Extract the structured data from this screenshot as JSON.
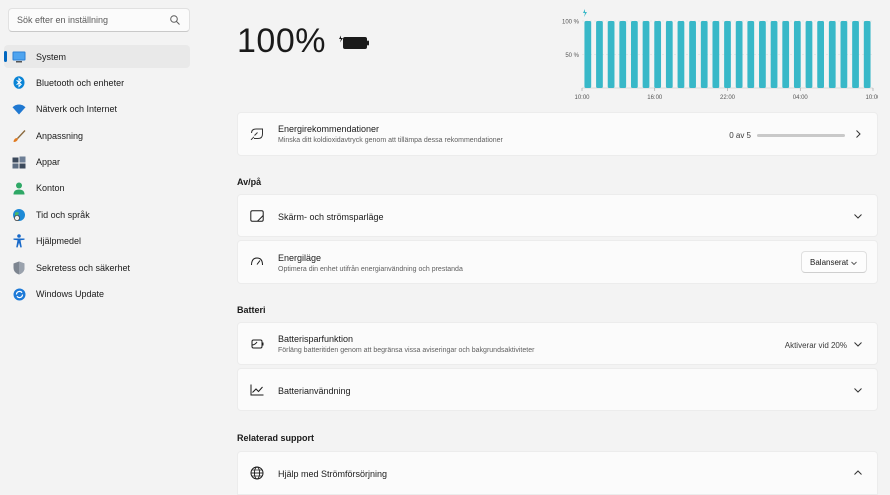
{
  "search": {
    "placeholder": "Sök efter en inställning"
  },
  "sidebar": {
    "items": [
      {
        "label": "System",
        "icon": "monitor-icon",
        "active": true
      },
      {
        "label": "Bluetooth och enheter",
        "icon": "bluetooth-icon"
      },
      {
        "label": "Nätverk och Internet",
        "icon": "wifi-icon"
      },
      {
        "label": "Anpassning",
        "icon": "brush-icon"
      },
      {
        "label": "Appar",
        "icon": "apps-icon"
      },
      {
        "label": "Konton",
        "icon": "person-icon"
      },
      {
        "label": "Tid och språk",
        "icon": "globe-clock-icon"
      },
      {
        "label": "Hjälpmedel",
        "icon": "accessibility-icon"
      },
      {
        "label": "Sekretess och säkerhet",
        "icon": "shield-icon"
      },
      {
        "label": "Windows Update",
        "icon": "update-icon"
      }
    ]
  },
  "battery": {
    "percent": "100%"
  },
  "chart_data": {
    "type": "bar",
    "title": "",
    "xlabel": "",
    "ylabel": "",
    "y_ticks": [
      "100 %",
      "50 %"
    ],
    "x_ticks": [
      "10:00",
      "16:00",
      "22:00",
      "04:00",
      "10:00"
    ],
    "ylim": [
      0,
      100
    ],
    "values": [
      100,
      100,
      100,
      100,
      100,
      100,
      100,
      100,
      100,
      100,
      100,
      100,
      100,
      100,
      100,
      100,
      100,
      100,
      100,
      100,
      100,
      100,
      100,
      100,
      100
    ],
    "bar_color": "#38b8c8"
  },
  "recommendations": {
    "title": "Energirekommendationer",
    "subtitle": "Minska ditt koldioxidavtryck genom att tillämpa dessa rekommendationer",
    "progress_text": "0 av 5",
    "progress": 0
  },
  "sections": {
    "onoff": "Av/på",
    "battery": "Batteri",
    "support": "Relaterad support"
  },
  "screen_sleep": {
    "title": "Skärm- och strömsparläge"
  },
  "power_mode": {
    "title": "Energiläge",
    "subtitle": "Optimera din enhet utifrån energianvändning och prestanda",
    "value": "Balanserat"
  },
  "battery_saver": {
    "title": "Batterisparfunktion",
    "subtitle": "Förläng batteritiden genom att begränsa vissa aviseringar och bakgrundsaktiviteter",
    "value": "Aktiverar vid 20%"
  },
  "battery_usage": {
    "title": "Batterianvändning"
  },
  "help": {
    "title": "Hjälp med Strömförsörjning"
  },
  "colors": {
    "accent": "#0067c0",
    "chart": "#38b8c8"
  }
}
